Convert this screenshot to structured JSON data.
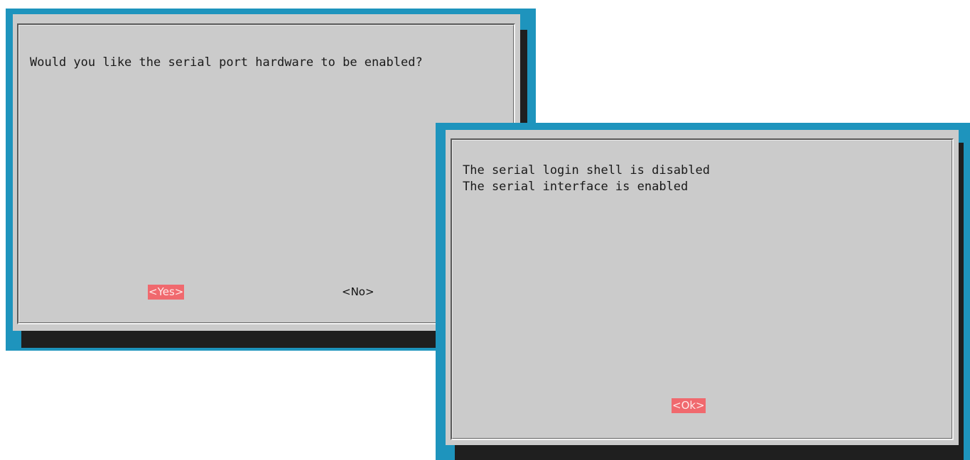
{
  "dialog_enable_serial": {
    "question": "Would you like the serial port hardware to be enabled?",
    "yes_label": "<Yes>",
    "no_label": "<No>",
    "selected": "yes"
  },
  "dialog_result": {
    "lines": [
      "The serial login shell is disabled",
      "The serial interface is enabled"
    ],
    "ok_label": "<Ok>",
    "selected": "ok"
  },
  "colors": {
    "terminal_background": "#1e94bd",
    "dialog_background": "#cbcbcb",
    "dialog_shadow": "#1f1f1f",
    "selected_button": "#f0696e"
  }
}
